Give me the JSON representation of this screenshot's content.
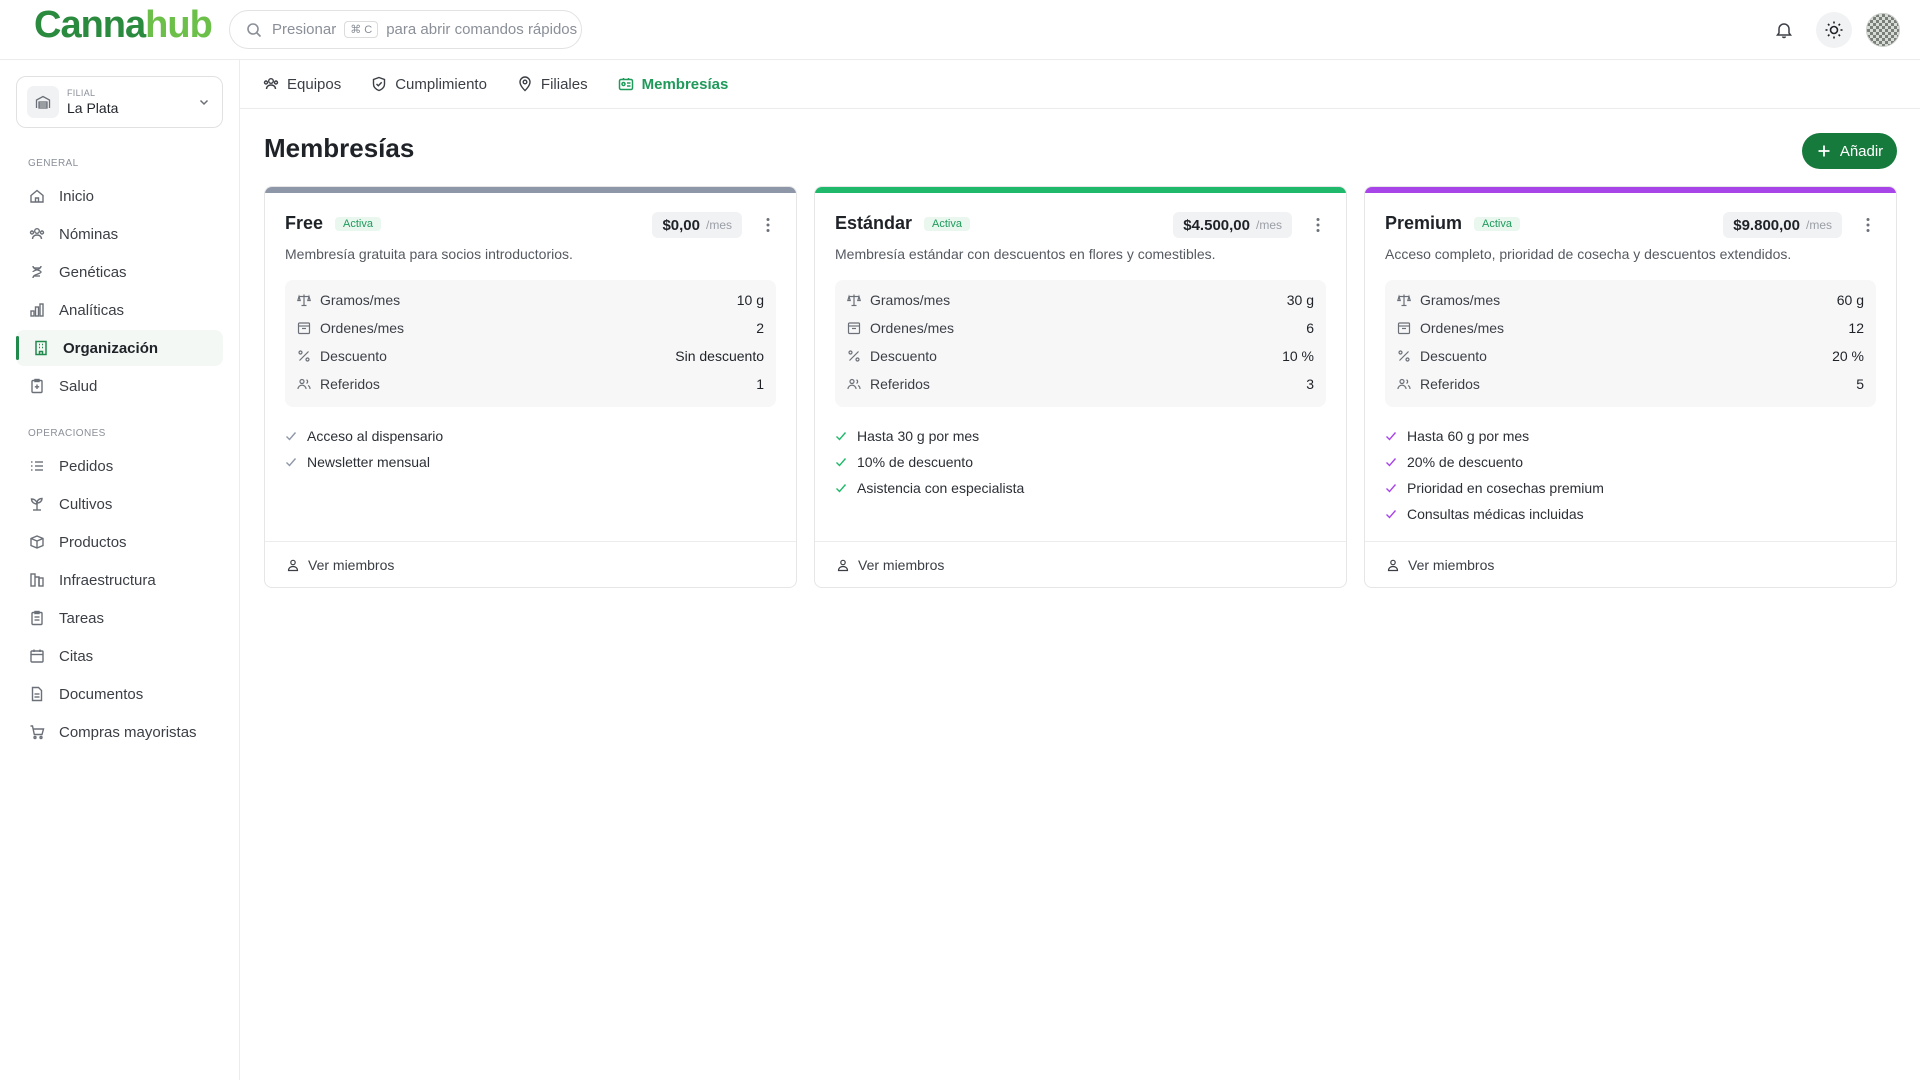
{
  "brand": {
    "part1": "Canna",
    "part2": "hub",
    "colors": {
      "primary": "#167a3c",
      "light": "#6cc04a"
    }
  },
  "search": {
    "prefix": "Presionar",
    "shortcut": "⌘ C",
    "suffix": "para abrir comandos rápidos"
  },
  "header": {
    "icons": [
      "bell-icon",
      "sun-icon",
      "user-avatar"
    ]
  },
  "branch_selector": {
    "caption": "FILIAL",
    "value": "La Plata"
  },
  "sidebar": {
    "general_label": "GENERAL",
    "general": [
      {
        "label": "Inicio",
        "icon": "home-icon"
      },
      {
        "label": "Nóminas",
        "icon": "users-icon"
      },
      {
        "label": "Genéticas",
        "icon": "dna-icon"
      },
      {
        "label": "Analíticas",
        "icon": "bar-chart-icon"
      },
      {
        "label": "Organización",
        "icon": "building-icon",
        "active": true
      },
      {
        "label": "Salud",
        "icon": "clipboard-icon"
      }
    ],
    "operations_label": "OPERACIONES",
    "operations": [
      {
        "label": "Pedidos",
        "icon": "list-icon"
      },
      {
        "label": "Cultivos",
        "icon": "sprout-icon"
      },
      {
        "label": "Productos",
        "icon": "package-icon"
      },
      {
        "label": "Infraestructura",
        "icon": "infrastructure-icon"
      },
      {
        "label": "Tareas",
        "icon": "clipboard-check-icon"
      },
      {
        "label": "Citas",
        "icon": "calendar-icon"
      },
      {
        "label": "Documentos",
        "icon": "file-icon"
      },
      {
        "label": "Compras mayoristas",
        "icon": "cart-icon"
      }
    ]
  },
  "tabs": [
    {
      "label": "Equipos",
      "icon": "team-icon"
    },
    {
      "label": "Cumplimiento",
      "icon": "shield-check-icon"
    },
    {
      "label": "Filiales",
      "icon": "map-pin-icon"
    },
    {
      "label": "Membresías",
      "icon": "id-card-icon",
      "active": true
    }
  ],
  "page": {
    "title": "Membresías",
    "add_label": "Añadir"
  },
  "stat_labels": {
    "grams": "Gramos/mes",
    "orders": "Ordenes/mes",
    "discount": "Descuento",
    "referrals": "Referidos"
  },
  "members_link": "Ver miembros",
  "plans": [
    {
      "name": "Free",
      "status": "Activa",
      "price": "$0,00",
      "period": "/mes",
      "description": "Membresía gratuita para socios introductorios.",
      "accent": "#8e97a8",
      "stats": {
        "grams": "10 g",
        "orders": "2",
        "discount": "Sin descuento",
        "referrals": "1"
      },
      "features": [
        "Acceso al dispensario",
        "Newsletter mensual"
      ]
    },
    {
      "name": "Estándar",
      "status": "Activa",
      "price": "$4.500,00",
      "period": "/mes",
      "description": "Membresía estándar con descuentos en flores y comestibles.",
      "accent": "#20b86a",
      "stats": {
        "grams": "30 g",
        "orders": "6",
        "discount": "10 %",
        "referrals": "3"
      },
      "features": [
        "Hasta 30 g por mes",
        "10% de descuento",
        "Asistencia con especialista"
      ]
    },
    {
      "name": "Premium",
      "status": "Activa",
      "price": "$9.800,00",
      "period": "/mes",
      "description": "Acceso completo, prioridad de cosecha y descuentos extendidos.",
      "accent": "#a845e8",
      "stats": {
        "grams": "60 g",
        "orders": "12",
        "discount": "20 %",
        "referrals": "5"
      },
      "features": [
        "Hasta 60 g por mes",
        "20% de descuento",
        "Prioridad en cosechas premium",
        "Consultas médicas incluidas"
      ]
    }
  ]
}
